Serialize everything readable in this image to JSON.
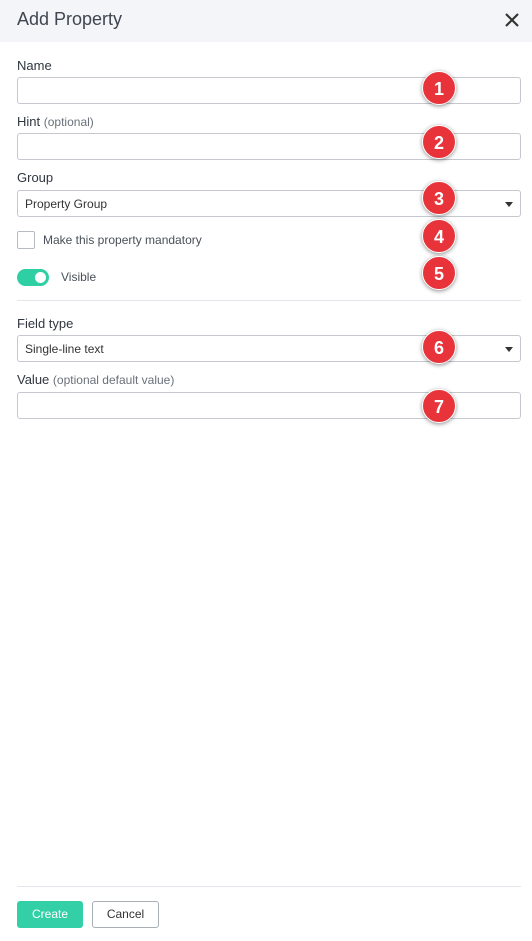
{
  "dialog": {
    "title": "Add Property"
  },
  "fields": {
    "name": {
      "label": "Name",
      "value": ""
    },
    "hint": {
      "label": "Hint",
      "note": "(optional)",
      "value": ""
    },
    "group": {
      "label": "Group",
      "selected": "Property Group"
    },
    "mandatory": {
      "label": "Make this property mandatory",
      "checked": false
    },
    "visible": {
      "label": "Visible",
      "on": true
    },
    "field_type": {
      "label": "Field type",
      "selected": "Single-line text"
    },
    "value": {
      "label": "Value",
      "note": "(optional default value)",
      "value": ""
    }
  },
  "badges": [
    "1",
    "2",
    "3",
    "4",
    "5",
    "6",
    "7"
  ],
  "footer": {
    "create_label": "Create",
    "cancel_label": "Cancel"
  },
  "colors": {
    "accent": "#33cfa6",
    "badge": "#e8333b",
    "header_bg": "#f3f5f8"
  }
}
